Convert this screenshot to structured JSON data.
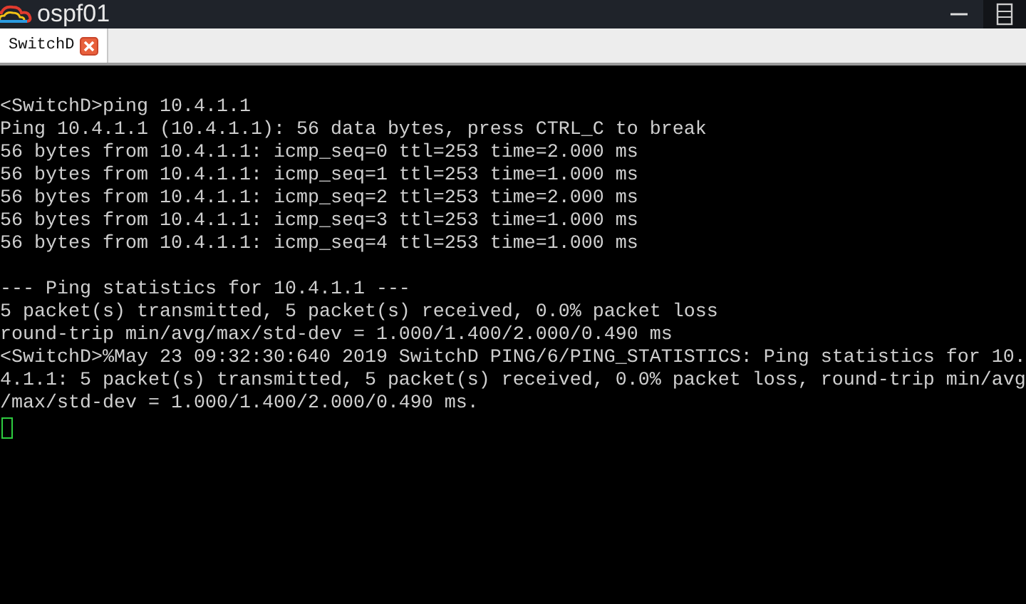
{
  "window": {
    "title": "ospf01"
  },
  "tabs": [
    {
      "label": "SwitchD",
      "selected": true
    }
  ],
  "terminal": {
    "blocks": [
      [
        "<SwitchD>ping 10.4.1.1",
        "Ping 10.4.1.1 (10.4.1.1): 56 data bytes, press CTRL_C to break",
        "56 bytes from 10.4.1.1: icmp_seq=0 ttl=253 time=2.000 ms",
        "56 bytes from 10.4.1.1: icmp_seq=1 ttl=253 time=1.000 ms",
        "56 bytes from 10.4.1.1: icmp_seq=2 ttl=253 time=2.000 ms",
        "56 bytes from 10.4.1.1: icmp_seq=3 ttl=253 time=1.000 ms",
        "56 bytes from 10.4.1.1: icmp_seq=4 ttl=253 time=1.000 ms"
      ],
      [
        "--- Ping statistics for 10.4.1.1 ---",
        "5 packet(s) transmitted, 5 packet(s) received, 0.0% packet loss",
        "round-trip min/avg/max/std-dev = 1.000/1.400/2.000/0.490 ms",
        "<SwitchD>%May 23 09:32:30:640 2019 SwitchD PING/6/PING_STATISTICS: Ping statistics for 10.",
        "4.1.1: 5 packet(s) transmitted, 5 packet(s) received, 0.0% packet loss, round-trip min/avg",
        "/max/std-dev = 1.000/1.400/2.000/0.490 ms."
      ]
    ]
  }
}
